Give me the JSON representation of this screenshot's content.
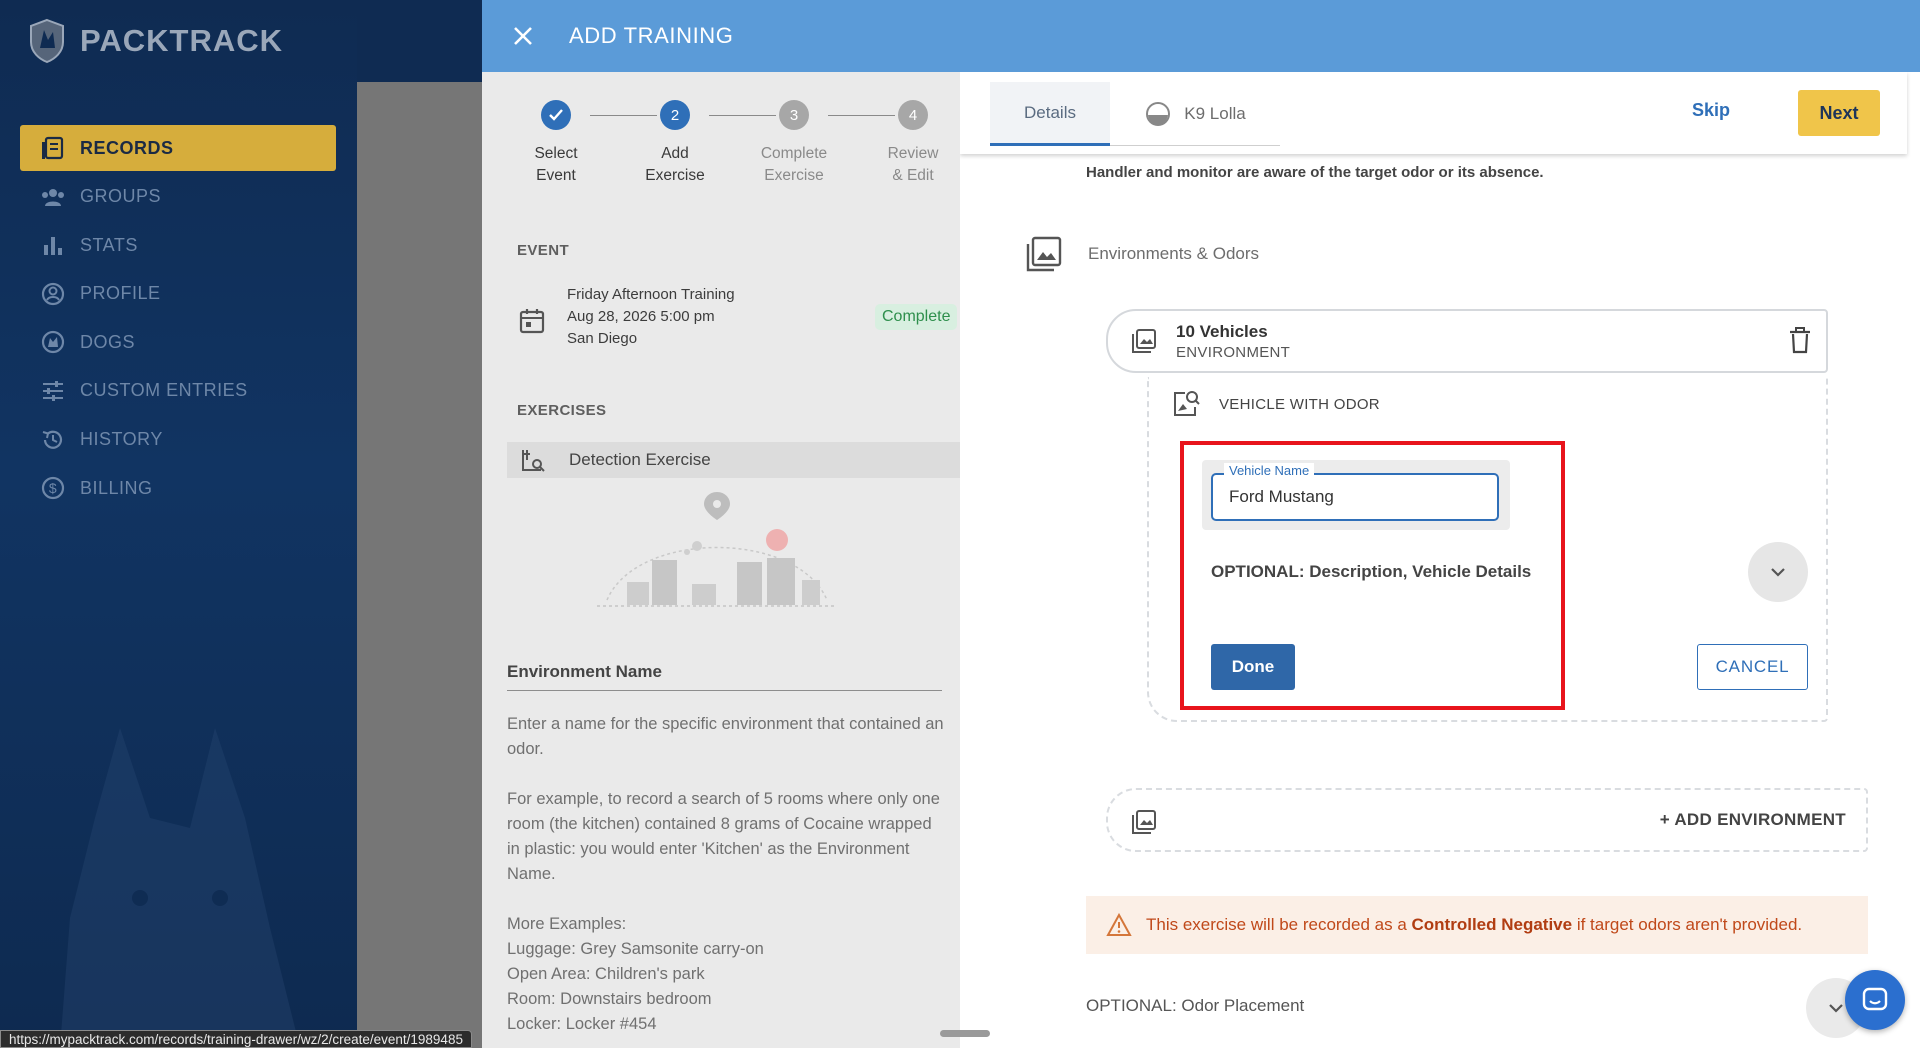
{
  "app": {
    "brand": "PACKTRACK"
  },
  "nav": {
    "items": [
      {
        "label": "RECORDS",
        "icon": "records-icon",
        "active": true
      },
      {
        "label": "GROUPS",
        "icon": "groups-icon"
      },
      {
        "label": "STATS",
        "icon": "stats-icon"
      },
      {
        "label": "PROFILE",
        "icon": "profile-icon"
      },
      {
        "label": "DOGS",
        "icon": "dogs-icon"
      },
      {
        "label": "CUSTOM ENTRIES",
        "icon": "sliders-icon"
      },
      {
        "label": "HISTORY",
        "icon": "history-icon"
      },
      {
        "label": "BILLING",
        "icon": "billing-icon"
      }
    ]
  },
  "drawer": {
    "title": "ADD TRAINING"
  },
  "stepper": {
    "steps": [
      {
        "number": "1",
        "line1": "Select",
        "line2": "Event",
        "state": "done"
      },
      {
        "number": "2",
        "line1": "Add",
        "line2": "Exercise",
        "state": "current"
      },
      {
        "number": "3",
        "line1": "Complete",
        "line2": "Exercise",
        "state": "todo"
      },
      {
        "number": "4",
        "line1": "Review",
        "line2": "& Edit",
        "state": "todo"
      }
    ]
  },
  "event": {
    "section_label": "EVENT",
    "name": "Friday Afternoon Training",
    "datetime": "Aug 28, 2026 5:00 pm",
    "location": "San Diego",
    "status": "Complete"
  },
  "exercises": {
    "section_label": "EXERCISES",
    "items": [
      {
        "label": "Detection Exercise"
      }
    ]
  },
  "help": {
    "heading": "Environment Name",
    "paragraph1": "Enter a name for the specific environment that contained an odor.",
    "paragraph2": "For example, to record a search of 5 rooms where only one room (the kitchen) contained 8 grams of Cocaine wrapped in plastic: you would enter 'Kitchen' as the Environment Name.",
    "more_title": "More Examples:",
    "examples": [
      "Luggage: Grey Samsonite carry-on",
      "Open Area: Children's park",
      "Room: Downstairs bedroom",
      "Locker: Locker #454"
    ]
  },
  "tabs": {
    "details": "Details",
    "dog": "K9 Lolla"
  },
  "actions": {
    "skip": "Skip",
    "next": "Next"
  },
  "details": {
    "handler_note": "Handler and monitor are aware of the target odor or its absence.",
    "env_odors_label": "Environments & Odors",
    "environment": {
      "name": "10 Vehicles",
      "type": "ENVIRONMENT"
    },
    "odor_header": "VEHICLE WITH ODOR",
    "vehicle_field": {
      "label": "Vehicle Name",
      "value": "Ford Mustang"
    },
    "optional_desc": "OPTIONAL: Description, Vehicle Details",
    "done": "Done",
    "cancel": "CANCEL",
    "add_environment": "+ ADD ENVIRONMENT",
    "warning_prefix": "This exercise will be recorded as a ",
    "warning_bold": "Controlled Negative",
    "warning_suffix": " if target odors aren't provided.",
    "odor_placement": "OPTIONAL: Odor Placement"
  },
  "status_url": "https://mypacktrack.com/records/training-drawer/wz/2/create/event/1989485",
  "colors": {
    "sidebar_bg": "#0f2b52",
    "active_nav": "#d6ad3c",
    "header_blue": "#5b9bd8",
    "primary": "#2f6fb8",
    "next_yellow": "#f0c54a",
    "highlight_red": "#e8141c",
    "warning_text": "#c0491a"
  }
}
